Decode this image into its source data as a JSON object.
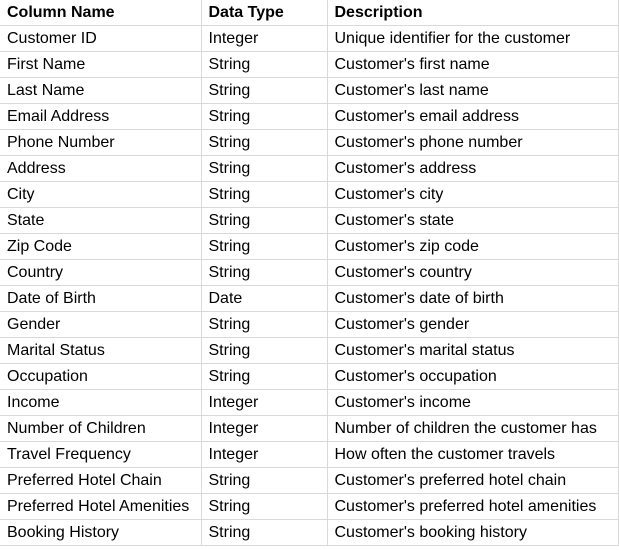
{
  "table": {
    "headers": [
      "Column Name",
      "Data Type",
      "Description"
    ],
    "rows": [
      [
        "Customer ID",
        "Integer",
        "Unique identifier for the customer"
      ],
      [
        "First Name",
        "String",
        "Customer's first name"
      ],
      [
        "Last Name",
        "String",
        "Customer's last name"
      ],
      [
        "Email Address",
        "String",
        "Customer's email address"
      ],
      [
        "Phone Number",
        "String",
        "Customer's phone number"
      ],
      [
        "Address",
        "String",
        "Customer's address"
      ],
      [
        "City",
        "String",
        "Customer's city"
      ],
      [
        "State",
        "String",
        "Customer's state"
      ],
      [
        "Zip Code",
        "String",
        "Customer's zip code"
      ],
      [
        "Country",
        "String",
        "Customer's country"
      ],
      [
        "Date of Birth",
        "Date",
        "Customer's date of birth"
      ],
      [
        "Gender",
        "String",
        "Customer's gender"
      ],
      [
        "Marital Status",
        "String",
        "Customer's marital status"
      ],
      [
        "Occupation",
        "String",
        "Customer's occupation"
      ],
      [
        "Income",
        "Integer",
        "Customer's income"
      ],
      [
        "Number of Children",
        "Integer",
        "Number of children the customer has"
      ],
      [
        "Travel Frequency",
        "Integer",
        "How often the customer travels"
      ],
      [
        "Preferred Hotel Chain",
        "String",
        "Customer's preferred hotel chain"
      ],
      [
        "Preferred Hotel Amenities",
        "String",
        "Customer's preferred hotel amenities"
      ],
      [
        "Booking History",
        "String",
        "Customer's booking history"
      ]
    ]
  }
}
